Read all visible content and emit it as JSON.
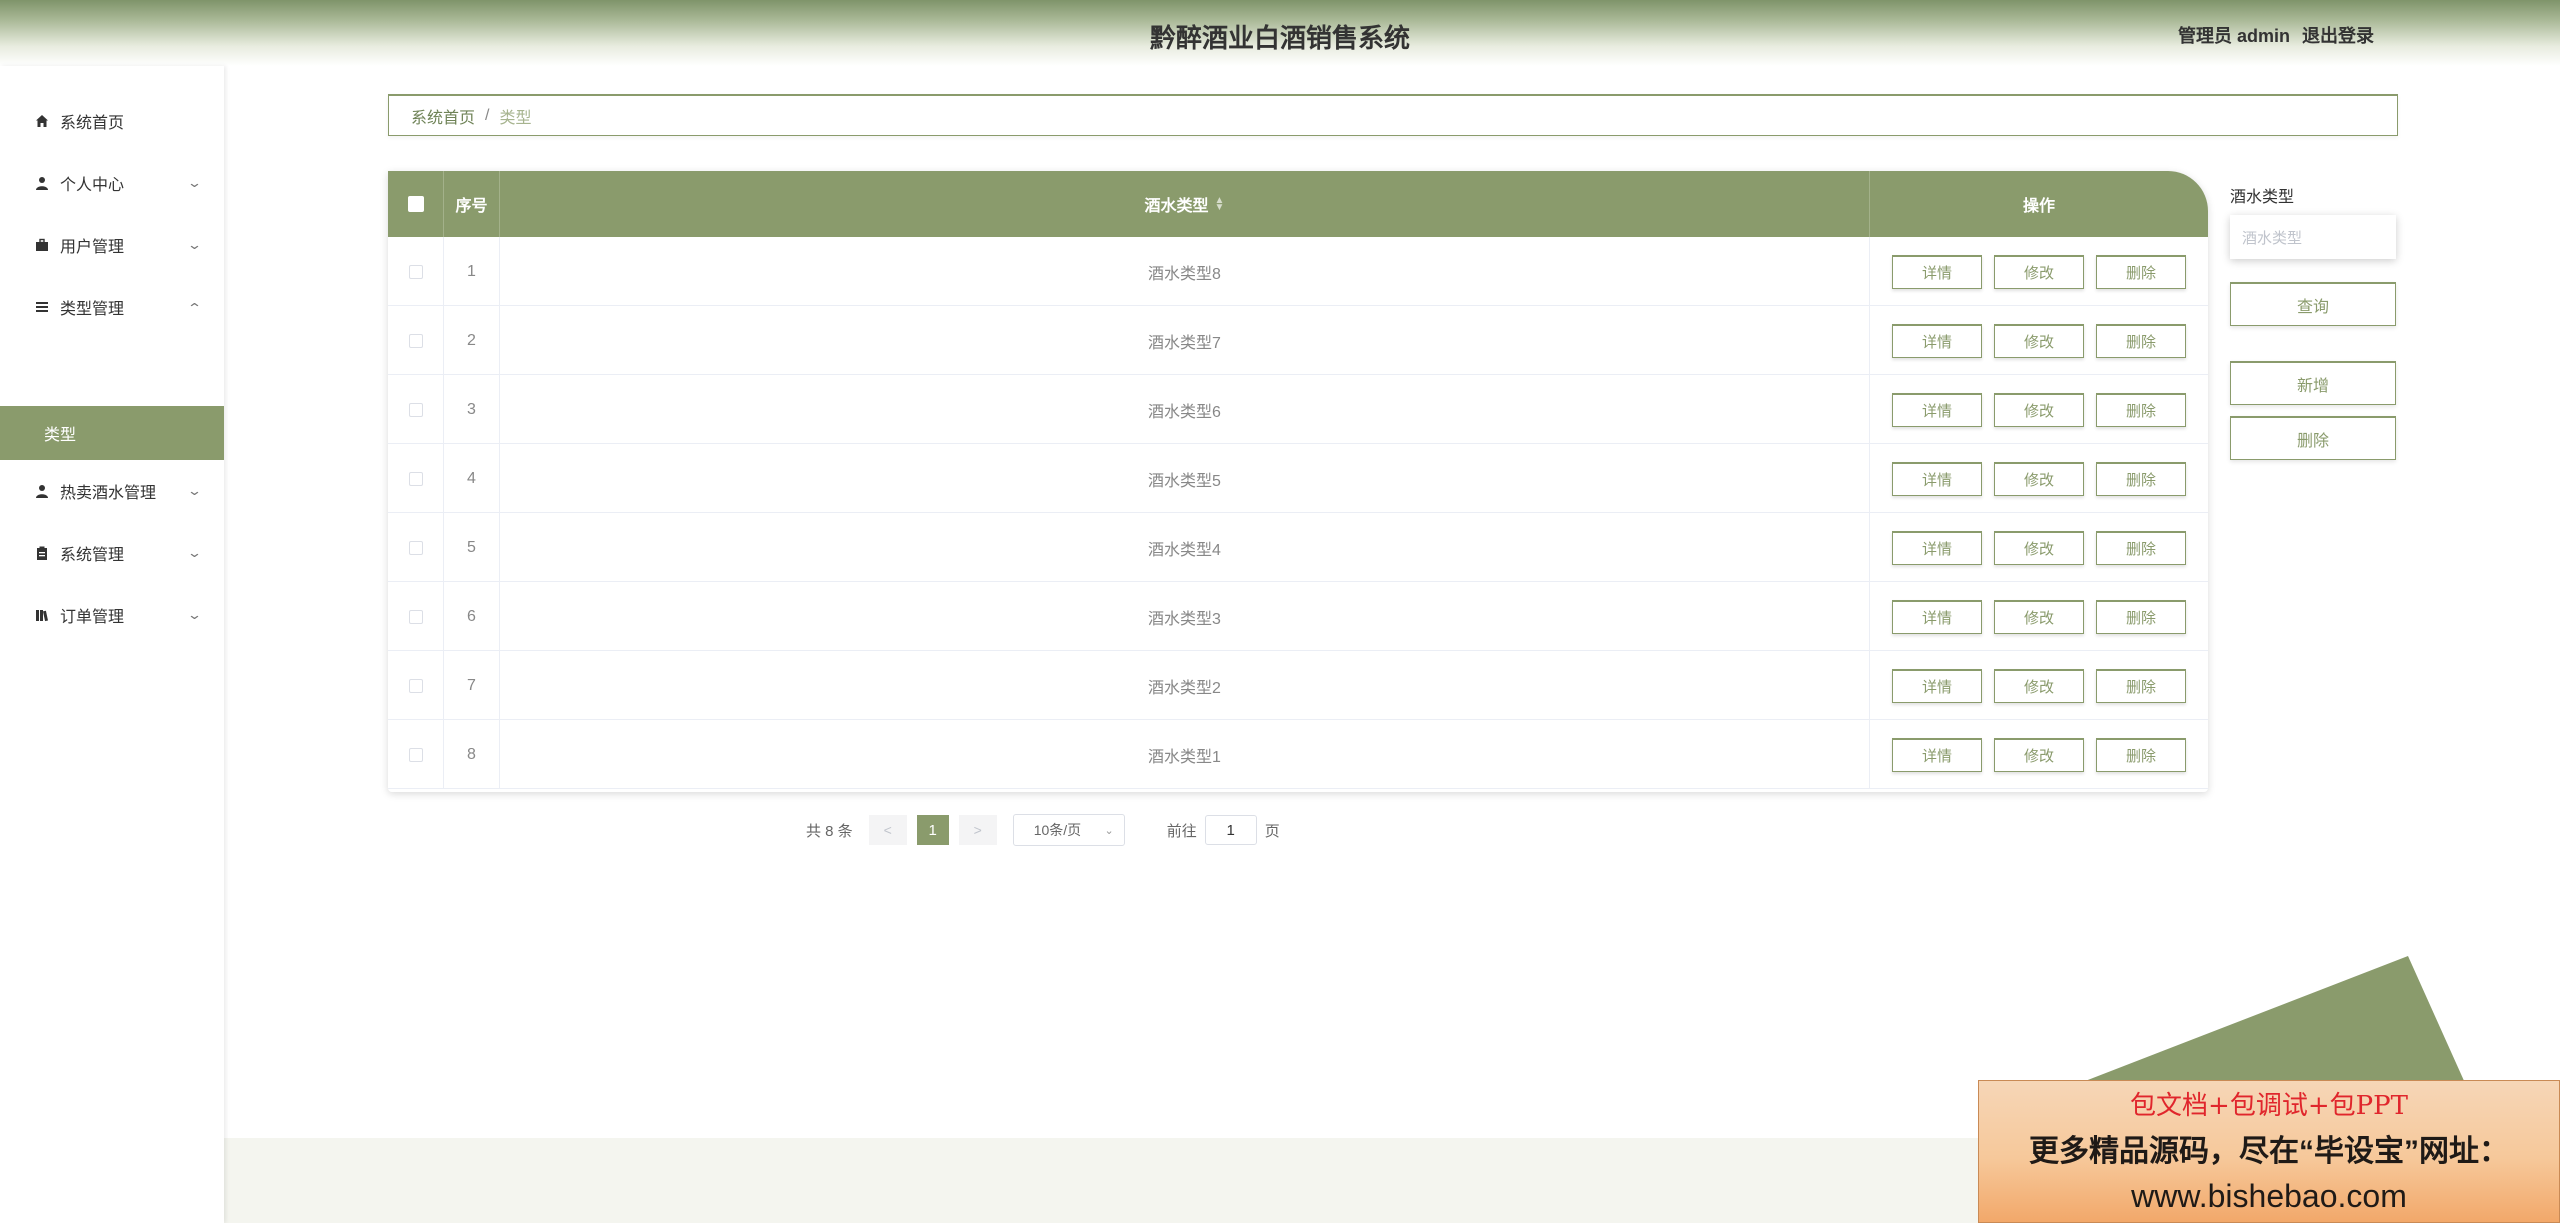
{
  "header": {
    "title": "黔醉酒业白酒销售系统",
    "role": "管理员 admin",
    "logout": "退出登录"
  },
  "sidebar": {
    "items": [
      {
        "label": "系统首页",
        "icon": "home-icon"
      },
      {
        "label": "个人中心",
        "icon": "user-icon"
      },
      {
        "label": "用户管理",
        "icon": "briefcase-icon"
      },
      {
        "label": "类型管理",
        "icon": "list-icon"
      },
      {
        "label": "热卖酒水管理",
        "icon": "user-icon"
      },
      {
        "label": "系统管理",
        "icon": "clipboard-icon"
      },
      {
        "label": "订单管理",
        "icon": "library-icon"
      }
    ],
    "active_sub": "类型"
  },
  "breadcrumb": {
    "home": "系统首页",
    "separator": "/",
    "current": "类型"
  },
  "table": {
    "columns": [
      "序号",
      "酒水类型",
      "操作"
    ],
    "rows": [
      {
        "idx": "1",
        "type": "酒水类型8"
      },
      {
        "idx": "2",
        "type": "酒水类型7"
      },
      {
        "idx": "3",
        "type": "酒水类型6"
      },
      {
        "idx": "4",
        "type": "酒水类型5"
      },
      {
        "idx": "5",
        "type": "酒水类型4"
      },
      {
        "idx": "6",
        "type": "酒水类型3"
      },
      {
        "idx": "7",
        "type": "酒水类型2"
      },
      {
        "idx": "8",
        "type": "酒水类型1"
      }
    ],
    "ops": {
      "detail": "详情",
      "edit": "修改",
      "delete": "删除"
    }
  },
  "pagination": {
    "total": "共 8 条",
    "prev": "<",
    "current": "1",
    "next": ">",
    "page_size": "10条/页",
    "goto_label": "前往",
    "goto_value": "1",
    "page_suffix": "页"
  },
  "search_panel": {
    "label": "酒水类型",
    "placeholder": "酒水类型",
    "query": "查询",
    "add": "新增",
    "delete": "删除"
  },
  "ad": {
    "line1": "包文档+包调试+包PPT",
    "line2": "更多精品源码，尽在“毕设宝”网址：",
    "line3": "www.bishebao.com"
  },
  "colors": {
    "accent": "#8a9b6c",
    "triangle": "#8a9b6c"
  }
}
